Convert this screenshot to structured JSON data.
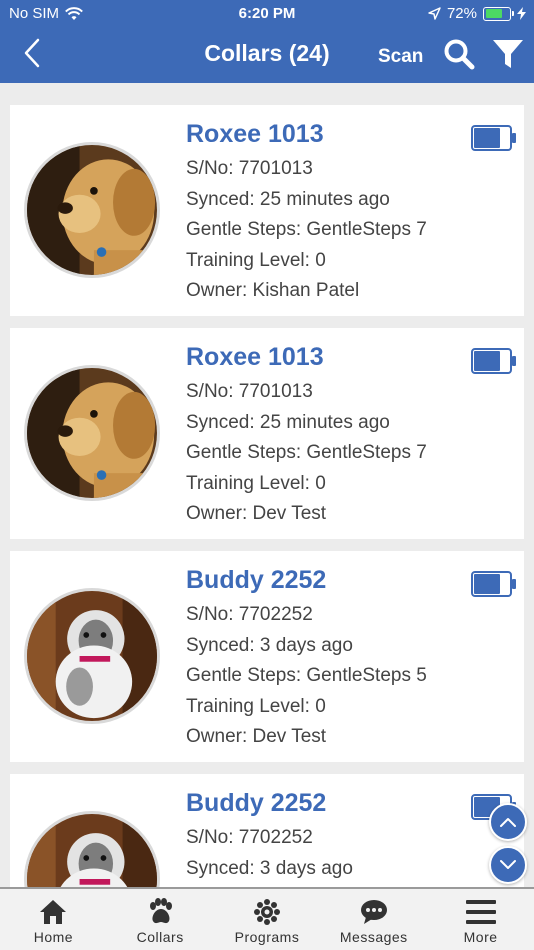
{
  "status": {
    "carrier": "No SIM",
    "time": "6:20 PM",
    "battery": "72%",
    "battery_level": 0.72
  },
  "nav": {
    "title": "Collars (24)",
    "scan_label": "Scan"
  },
  "collars": [
    {
      "name": "Roxee 1013",
      "serial": "S/No: 7701013",
      "synced": "Synced: 25 minutes ago",
      "steps": "Gentle Steps: GentleSteps 7",
      "training": "Training Level: 0",
      "owner": "Owner: Kishan Patel"
    },
    {
      "name": "Roxee 1013",
      "serial": "S/No: 7701013",
      "synced": "Synced: 25 minutes ago",
      "steps": "Gentle Steps: GentleSteps 7",
      "training": "Training Level: 0",
      "owner": "Owner: Dev Test"
    },
    {
      "name": "Buddy 2252",
      "serial": "S/No: 7702252",
      "synced": "Synced: 3 days ago",
      "steps": "Gentle Steps: GentleSteps 5",
      "training": "Training Level: 0",
      "owner": "Owner: Dev Test"
    },
    {
      "name": "Buddy 2252",
      "serial": "S/No: 7702252",
      "synced": "Synced: 3 days ago"
    }
  ],
  "tabs": [
    {
      "label": "Home",
      "icon": "home-icon"
    },
    {
      "label": "Collars",
      "icon": "paw-icon"
    },
    {
      "label": "Programs",
      "icon": "programs-icon"
    },
    {
      "label": "Messages",
      "icon": "messages-icon"
    },
    {
      "label": "More",
      "icon": "menu-icon"
    }
  ],
  "colors": {
    "primary": "#3d6ab7",
    "text": "#444444",
    "background": "#ececec"
  }
}
